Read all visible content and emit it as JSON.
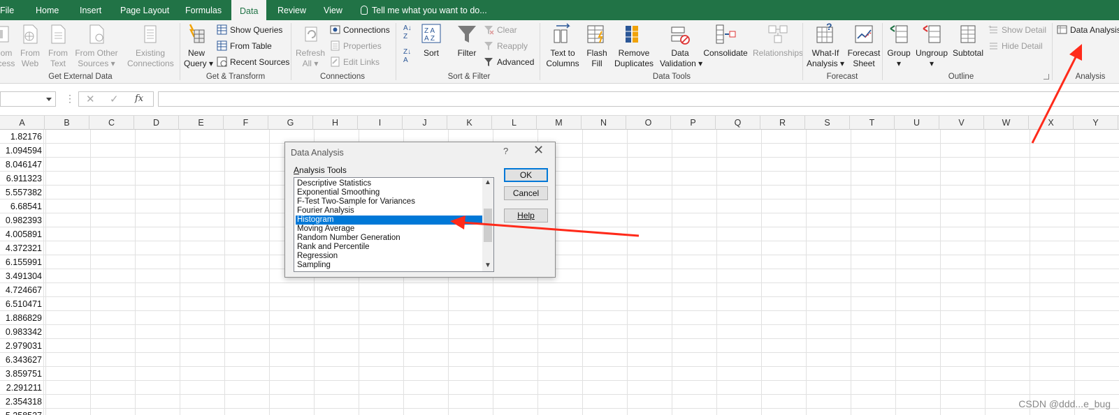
{
  "menu_tabs": [
    "File",
    "Home",
    "Insert",
    "Page Layout",
    "Formulas",
    "Data",
    "Review",
    "View"
  ],
  "active_tab": "Data",
  "tell_me": "Tell me what you want to do...",
  "ribbon": {
    "get_external": {
      "label": "Get External Data",
      "b1": [
        "om",
        "cess"
      ],
      "b2": [
        "From",
        "Web"
      ],
      "b3": [
        "From",
        "Text"
      ],
      "b4": [
        "From Other",
        "Sources"
      ],
      "b5": [
        "Existing",
        "Connections"
      ]
    },
    "get_transform": {
      "label": "Get & Transform",
      "new_query": [
        "New",
        "Query"
      ],
      "show_queries": "Show Queries",
      "from_table": "From Table",
      "recent_sources": "Recent Sources"
    },
    "connections": {
      "label": "Connections",
      "refresh_all": [
        "Refresh",
        "All"
      ],
      "connections": "Connections",
      "properties": "Properties",
      "edit_links": "Edit Links"
    },
    "sort_filter": {
      "label": "Sort & Filter",
      "sort": "Sort",
      "filter": "Filter",
      "clear": "Clear",
      "reapply": "Reapply",
      "advanced": "Advanced"
    },
    "data_tools": {
      "label": "Data Tools",
      "text_to_columns": [
        "Text to",
        "Columns"
      ],
      "flash_fill": [
        "Flash",
        "Fill"
      ],
      "remove_duplicates": [
        "Remove",
        "Duplicates"
      ],
      "data_validation": [
        "Data",
        "Validation"
      ],
      "consolidate": "Consolidate",
      "relationships": "Relationships"
    },
    "forecast": {
      "label": "Forecast",
      "what_if": [
        "What-If",
        "Analysis"
      ],
      "forecast_sheet": [
        "Forecast",
        "Sheet"
      ]
    },
    "outline": {
      "label": "Outline",
      "group": "Group",
      "ungroup": "Ungroup",
      "subtotal": "Subtotal",
      "show_detail": "Show Detail",
      "hide_detail": "Hide Detail"
    },
    "analysis": {
      "label": "Analysis",
      "data_analysis": "Data Analysis"
    }
  },
  "formula_bar": {
    "name_box": "",
    "fx": "fx",
    "content": ""
  },
  "columns": [
    "A",
    "B",
    "C",
    "D",
    "E",
    "F",
    "G",
    "H",
    "I",
    "J",
    "K",
    "L",
    "M",
    "N",
    "O",
    "P",
    "Q",
    "R",
    "S",
    "T",
    "U",
    "V",
    "W",
    "X",
    "Y"
  ],
  "column_a_values": [
    "1.82176",
    "1.094594",
    "8.046147",
    "6.911323",
    "5.557382",
    "6.68541",
    "0.982393",
    "4.005891",
    "4.372321",
    "6.155991",
    "3.491304",
    "4.724667",
    "6.510471",
    "1.886829",
    "0.983342",
    "2.979031",
    "6.343627",
    "3.859751",
    "2.291211",
    "2.354318",
    "5.258527"
  ],
  "dialog": {
    "title": "Data Analysis",
    "help_glyph": "?",
    "close_glyph": "✕",
    "list_label_first": "A",
    "list_label_rest": "nalysis Tools",
    "items": [
      "Descriptive Statistics",
      "Exponential Smoothing",
      "F-Test Two-Sample for Variances",
      "Fourier Analysis",
      "Histogram",
      "Moving Average",
      "Random Number Generation",
      "Rank and Percentile",
      "Regression",
      "Sampling"
    ],
    "selected": "Histogram",
    "ok": "OK",
    "cancel": "Cancel",
    "help": "Help"
  },
  "watermark": "CSDN @ddd...e_bug",
  "colors": {
    "excel_green": "#217346",
    "selection_blue": "#0078d7",
    "annotation_red": "#ff2a1a"
  }
}
